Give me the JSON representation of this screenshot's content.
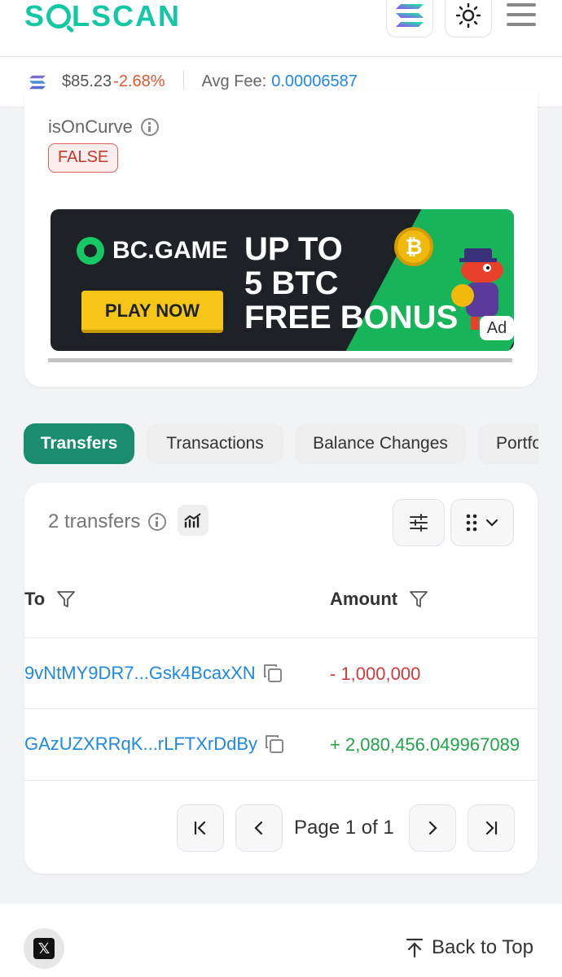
{
  "header": {
    "logo_text_left": "S",
    "logo_text_right": "LSCAN",
    "icons": [
      "solana-logo-icon",
      "theme-sun-icon",
      "hamburger-menu-icon"
    ]
  },
  "pricebar": {
    "price": "$85.23",
    "change": "-2.68%",
    "fee_label": "Avg Fee:",
    "fee_value": "0.00006587"
  },
  "account": {
    "curve_label": "isOnCurve",
    "curve_value": "FALSE"
  },
  "ad": {
    "brand": "BC.GAME",
    "cta": "PLAY NOW",
    "headline_1": "UP TO",
    "headline_2": "5 BTC",
    "headline_3": "FREE BONUS",
    "coin": "₿",
    "tag": "Ad"
  },
  "tabs": [
    {
      "label": "Transfers",
      "active": true
    },
    {
      "label": "Transactions",
      "active": false
    },
    {
      "label": "Balance Changes",
      "active": false
    },
    {
      "label": "Portfo",
      "active": false
    }
  ],
  "transfers": {
    "count_text": "2 transfers",
    "columns": [
      "To",
      "Amount"
    ],
    "rows": [
      {
        "to": "9vNtMY9DR7...Gsk4BcaxXN",
        "amount": "- 1,000,000",
        "direction": "out"
      },
      {
        "to": "GAzUZXRRqK...rLFTXrDdBy",
        "amount": "+ 2,080,456.049967089",
        "direction": "in"
      }
    ],
    "pagination": "Page 1 of 1"
  },
  "footer": {
    "x_label": "𝕏",
    "back_to_top": "Back to Top"
  },
  "colors": {
    "brand": "#14c8a5",
    "active_tab": "#1b8d6f",
    "link": "#1e88e5",
    "negative": "#d23c3c",
    "positive": "#22a34a"
  }
}
